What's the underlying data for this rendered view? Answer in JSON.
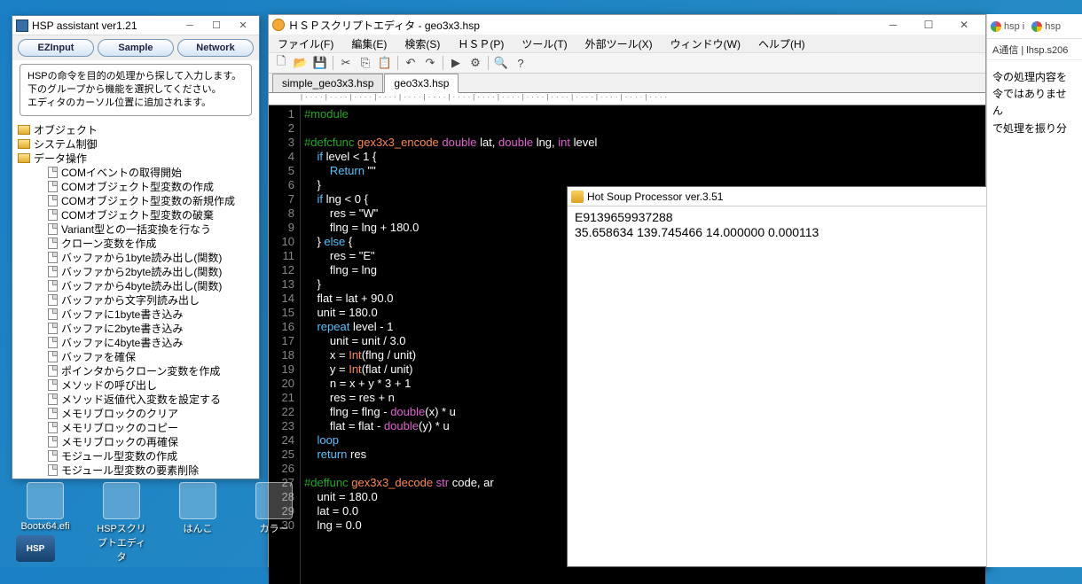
{
  "assistant": {
    "title": "HSP assistant ver1.21",
    "tabs": [
      "EZInput",
      "Sample",
      "Network"
    ],
    "hint": "HSPの命令を目的の処理から探して入力します。\n下のグループから機能を選択してください。\nエディタのカーソル位置に追加されます。",
    "folders": [
      "オブジェクト",
      "システム制御",
      "データ操作"
    ],
    "items": [
      "COMイベントの取得開始",
      "COMオブジェクト型変数の作成",
      "COMオブジェクト型変数の新規作成",
      "COMオブジェクト型変数の破棄",
      "Variant型との一括変換を行なう",
      "クローン変数を作成",
      "バッファから1byte読み出し(関数)",
      "バッファから2byte読み出し(関数)",
      "バッファから4byte読み出し(関数)",
      "バッファから文字列読み出し",
      "バッファに1byte書き込み",
      "バッファに2byte書き込み",
      "バッファに4byte書き込み",
      "バッファを確保",
      "ポインタからクローン変数を作成",
      "メソッドの呼び出し",
      "メソッド返値代入変数を設定する",
      "メモリブロックのクリア",
      "メモリブロックのコピー",
      "メモリブロックの再確保",
      "モジュール型変数の作成",
      "モジュール型変数の要素削除"
    ]
  },
  "editor": {
    "title": "ＨＳＰスクリプトエディタ - geo3x3.hsp",
    "menus": [
      "ファイル(F)",
      "編集(E)",
      "検索(S)",
      "ＨＳＰ(P)",
      "ツール(T)",
      "外部ツール(X)",
      "ウィンドウ(W)",
      "ヘルプ(H)"
    ],
    "filetabs": [
      "simple_geo3x3.hsp",
      "geo3x3.hsp"
    ],
    "active_tab": 1,
    "code_lines": [
      {
        "n": 1,
        "pre": "#module"
      },
      {
        "n": 2,
        "raw": ""
      },
      {
        "n": 3,
        "seg": [
          [
            "pre",
            "#defcfunc"
          ],
          [
            "fn",
            " gex3x3_encode "
          ],
          [
            "ty",
            "double"
          ],
          [
            "p",
            " lat, "
          ],
          [
            "ty",
            "double"
          ],
          [
            "p",
            " lng, "
          ],
          [
            "ty",
            "int"
          ],
          [
            "p",
            " level"
          ]
        ]
      },
      {
        "n": 4,
        "seg": [
          [
            "p",
            "    "
          ],
          [
            "kw",
            "if"
          ],
          [
            "p",
            " level < 1 {"
          ]
        ]
      },
      {
        "n": 5,
        "seg": [
          [
            "p",
            "        "
          ],
          [
            "kw",
            "Return"
          ],
          [
            "p",
            " \"\""
          ]
        ]
      },
      {
        "n": 6,
        "raw": "    }"
      },
      {
        "n": 7,
        "seg": [
          [
            "p",
            "    "
          ],
          [
            "kw",
            "if"
          ],
          [
            "p",
            " lng < 0 {"
          ]
        ]
      },
      {
        "n": 8,
        "raw": "        res = \"W\""
      },
      {
        "n": 9,
        "raw": "        flng = lng + 180.0"
      },
      {
        "n": 10,
        "seg": [
          [
            "p",
            "    } "
          ],
          [
            "kw",
            "else"
          ],
          [
            "p",
            " {"
          ]
        ]
      },
      {
        "n": 11,
        "raw": "        res = \"E\""
      },
      {
        "n": 12,
        "raw": "        flng = lng"
      },
      {
        "n": 13,
        "raw": "    }"
      },
      {
        "n": 14,
        "raw": "    flat = lat + 90.0"
      },
      {
        "n": 15,
        "raw": "    unit = 180.0"
      },
      {
        "n": 16,
        "seg": [
          [
            "p",
            "    "
          ],
          [
            "kw",
            "repeat"
          ],
          [
            "p",
            " level - 1"
          ]
        ]
      },
      {
        "n": 17,
        "raw": "        unit = unit / 3.0"
      },
      {
        "n": 18,
        "seg": [
          [
            "p",
            "        x = "
          ],
          [
            "fn",
            "Int"
          ],
          [
            "p",
            "(flng / unit)"
          ]
        ]
      },
      {
        "n": 19,
        "seg": [
          [
            "p",
            "        y = "
          ],
          [
            "fn",
            "Int"
          ],
          [
            "p",
            "(flat / unit)"
          ]
        ]
      },
      {
        "n": 20,
        "raw": "        n = x + y * 3 + 1"
      },
      {
        "n": 21,
        "raw": "        res = res + n"
      },
      {
        "n": 22,
        "seg": [
          [
            "p",
            "        flng = flng - "
          ],
          [
            "ty",
            "double"
          ],
          [
            "p",
            "(x) * u"
          ]
        ]
      },
      {
        "n": 23,
        "seg": [
          [
            "p",
            "        flat = flat - "
          ],
          [
            "ty",
            "double"
          ],
          [
            "p",
            "(y) * u"
          ]
        ]
      },
      {
        "n": 24,
        "seg": [
          [
            "p",
            "    "
          ],
          [
            "kw",
            "loop"
          ]
        ]
      },
      {
        "n": 25,
        "seg": [
          [
            "p",
            "    "
          ],
          [
            "kw",
            "return"
          ],
          [
            "p",
            " res"
          ]
        ]
      },
      {
        "n": 26,
        "raw": ""
      },
      {
        "n": 27,
        "seg": [
          [
            "pre",
            "#deffunc"
          ],
          [
            "fn",
            " gex3x3_decode "
          ],
          [
            "ty",
            "str"
          ],
          [
            "p",
            " code, ar"
          ]
        ]
      },
      {
        "n": 28,
        "raw": "    unit = 180.0"
      },
      {
        "n": 29,
        "raw": "    lat = 0.0"
      },
      {
        "n": 30,
        "raw": "    lng = 0.0"
      }
    ]
  },
  "output": {
    "title": "Hot Soup Processor ver.3.51",
    "lines": [
      "E9139659937288",
      "35.658634 139.745466 14.000000 0.000113"
    ]
  },
  "browser": {
    "tabs": [
      "hsp i",
      "hsp"
    ],
    "url": "A通信 | lhsp.s206",
    "body": [
      "令の処理内容を",
      "令ではありません",
      "で処理を振り分"
    ]
  },
  "desktop": {
    "icons": [
      "Bootx64.efi",
      "HSPスクリプトエディタ",
      "はんこ",
      "カラー"
    ]
  }
}
